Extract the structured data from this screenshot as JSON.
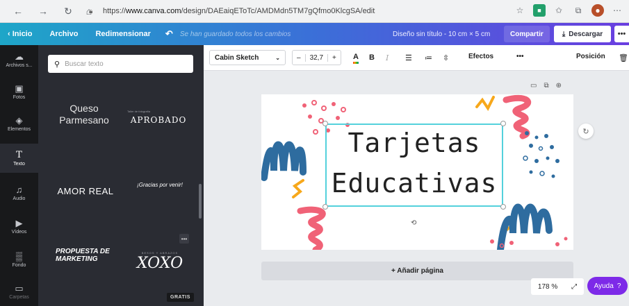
{
  "browser": {
    "url_prefix": "https://",
    "url_host": "www.canva.com",
    "url_path": "/design/DAEaiqEToTc/AMDMdn5TM7gQfmo0KlcgSA/edit"
  },
  "topbar": {
    "back_label": "Inicio",
    "file_label": "Archivo",
    "resize_label": "Redimensionar",
    "saved_status": "Se han guardado todos los cambios",
    "design_title": "Diseño sin título - 10 cm × 5 cm",
    "share_label": "Compartir",
    "download_label": "Descargar",
    "more_label": "•••"
  },
  "rail": {
    "items": [
      {
        "icon": "☁",
        "label": "Archivos s..."
      },
      {
        "icon": "▣",
        "label": "Fotos"
      },
      {
        "icon": "◈",
        "label": "Elementos"
      },
      {
        "icon": "T",
        "label": "Texto"
      },
      {
        "icon": "♫",
        "label": "Audio"
      },
      {
        "icon": "▶",
        "label": "Vídeos"
      },
      {
        "icon": "▒",
        "label": "Fondo"
      },
      {
        "icon": "▭",
        "label": "Carpetas"
      }
    ]
  },
  "panel": {
    "search_placeholder": "Buscar texto",
    "tiles": {
      "t1_line1": "Queso",
      "t1_line2": "Parmesano",
      "t2_small": "Taller de fotografía",
      "t2_title": "APROBADO",
      "t3_title": "AMOR REAL",
      "t4_title": "¡Gracias por venir!",
      "t5_line1": "PROPUESTA DE",
      "t5_line2": "MARKETING",
      "t6_small": "BESOS Y ABRAZOS",
      "t6_title": "XOXO"
    },
    "badge": "GRATIS",
    "more": "•••"
  },
  "toolbar": {
    "font_name": "Cabin Sketch",
    "size_minus": "–",
    "font_size": "32,7",
    "size_plus": "+",
    "color_letter": "A",
    "bold": "B",
    "italic": "I",
    "effects_label": "Efectos",
    "more_label": "•••",
    "position_label": "Posición"
  },
  "canvas": {
    "title_line1": "Tarjetas",
    "title_line2": "Educativas"
  },
  "footer": {
    "add_page_label": "+ Añadir página",
    "zoom_value": "178 %",
    "help_label": "Ayuda",
    "help_icon": "?"
  },
  "colors": {
    "accent_purple": "#7d2ae8",
    "deco_pink": "#f06277",
    "deco_blue": "#2e6c9f",
    "deco_orange": "#f7a81b",
    "selection": "#53d1dc"
  }
}
